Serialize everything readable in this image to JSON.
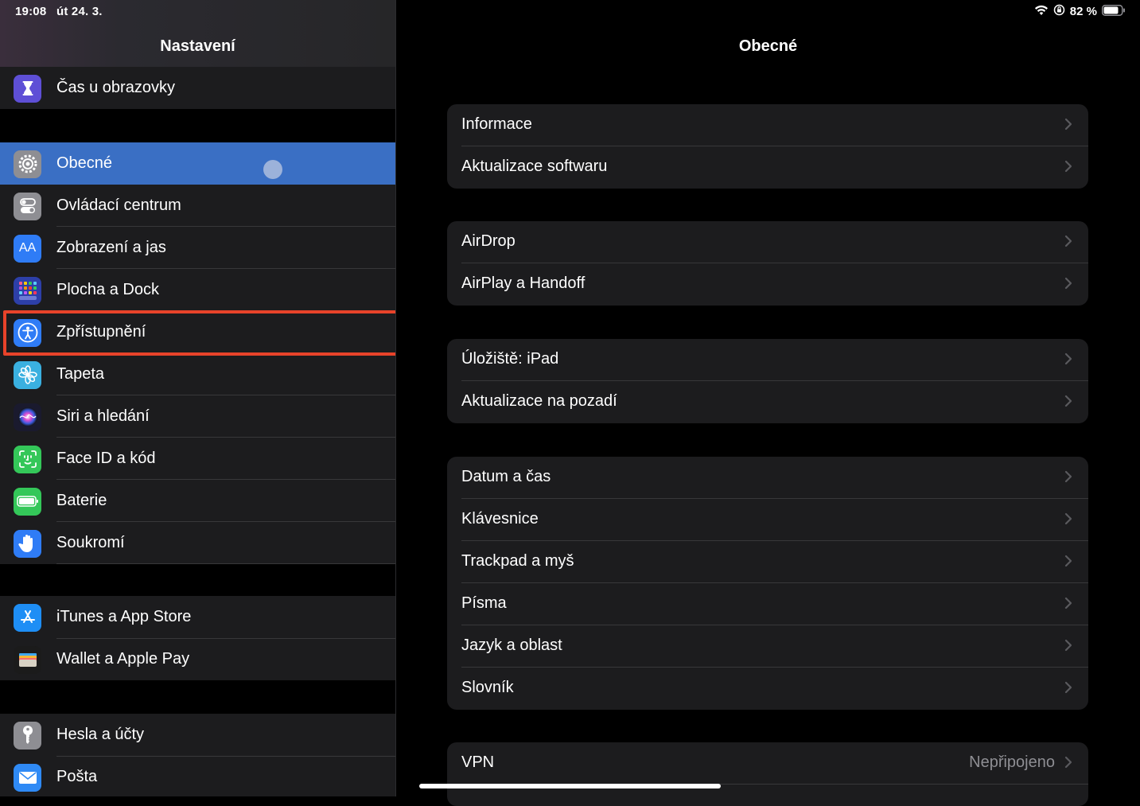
{
  "status_bar": {
    "time": "19:08",
    "date": "út 24. 3.",
    "battery": "82 %"
  },
  "sidebar": {
    "title": "Nastavení",
    "group0": [
      {
        "label": "Čas u obrazovky",
        "icon": "hourglass-icon"
      }
    ],
    "group1": [
      {
        "label": "Obecné",
        "icon": "gear-icon",
        "selected": true
      },
      {
        "label": "Ovládací centrum",
        "icon": "toggles-icon"
      },
      {
        "label": "Zobrazení a jas",
        "icon": "text-size-icon"
      },
      {
        "label": "Plocha a Dock",
        "icon": "app-grid-icon"
      },
      {
        "label": "Zpřístupnění",
        "icon": "accessibility-icon",
        "highlighted": true
      },
      {
        "label": "Tapeta",
        "icon": "flower-icon"
      },
      {
        "label": "Siri a hledání",
        "icon": "siri-icon"
      },
      {
        "label": "Face ID a kód",
        "icon": "face-id-icon"
      },
      {
        "label": "Baterie",
        "icon": "battery-icon"
      },
      {
        "label": "Soukromí",
        "icon": "hand-icon"
      }
    ],
    "group2": [
      {
        "label": "iTunes a App Store",
        "icon": "app-store-icon"
      },
      {
        "label": "Wallet a Apple Pay",
        "icon": "wallet-icon"
      }
    ],
    "group3": [
      {
        "label": "Hesla a účty",
        "icon": "key-icon"
      },
      {
        "label": "Pošta",
        "icon": "mail-icon"
      }
    ]
  },
  "main": {
    "title": "Obecné",
    "sections": [
      [
        {
          "label": "Informace"
        },
        {
          "label": "Aktualizace softwaru"
        }
      ],
      [
        {
          "label": "AirDrop"
        },
        {
          "label": "AirPlay a Handoff"
        }
      ],
      [
        {
          "label": "Úložiště: iPad"
        },
        {
          "label": "Aktualizace na pozadí"
        }
      ],
      [
        {
          "label": "Datum a čas"
        },
        {
          "label": "Klávesnice"
        },
        {
          "label": "Trackpad a myš"
        },
        {
          "label": "Písma"
        },
        {
          "label": "Jazyk a oblast"
        },
        {
          "label": "Slovník"
        }
      ],
      [
        {
          "label": "VPN",
          "value": "Nepřipojeno"
        }
      ]
    ]
  },
  "colors": {
    "selected_row": "#3a6fc4",
    "highlight_border": "#e8432a",
    "cell_bg": "#1c1c1e"
  }
}
